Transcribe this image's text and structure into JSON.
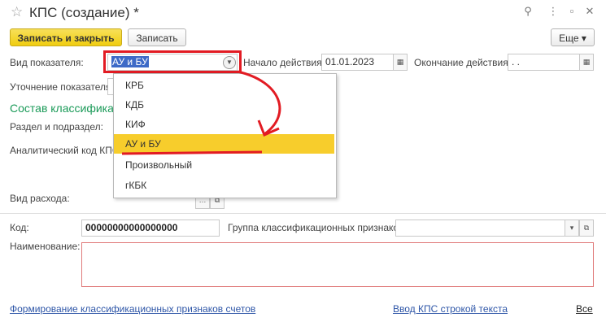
{
  "window": {
    "title": "КПС (создание) *",
    "icons": [
      "star-icon",
      "link-icon",
      "more-icon",
      "minimize-icon",
      "maximize-icon",
      "close-icon"
    ]
  },
  "toolbar": {
    "save_close_label": "Записать и закрыть",
    "save_label": "Записать",
    "more_label": "Еще ▾"
  },
  "form": {
    "indicator_type_label": "Вид показателя:",
    "indicator_type_value": "АУ и БУ",
    "start_label": "Начало действия:",
    "start_value": "01.01.2023",
    "end_label": "Окончание действия:",
    "end_value": " .  .",
    "refine_label": "Уточнение показателя:",
    "section_title": "Состав классифика",
    "razdel_label": "Раздел и подраздел:",
    "analytic_label": "Аналитический код КПС",
    "expense_label": "Вид расхода:",
    "code_label": "Код:",
    "code_value": "00000000000000000",
    "group_label": "Группа классификационных признаков:",
    "name_label": "Наименование:",
    "name_value": ""
  },
  "dropdown": {
    "options": [
      "КРБ",
      "КДБ",
      "КИФ",
      "АУ и БУ",
      "Произвольный",
      "гКБК"
    ],
    "selected": "АУ и БУ"
  },
  "footer": {
    "link_left": "Формирование классификационных признаков счетов",
    "link_mid": "Ввод КПС строкой текста",
    "link_right": "Все"
  },
  "colors": {
    "accent_yellow": "#f0cd10",
    "annotation_red": "#e21b23",
    "section_green": "#1a9a58",
    "link_blue": "#2d55a7"
  }
}
